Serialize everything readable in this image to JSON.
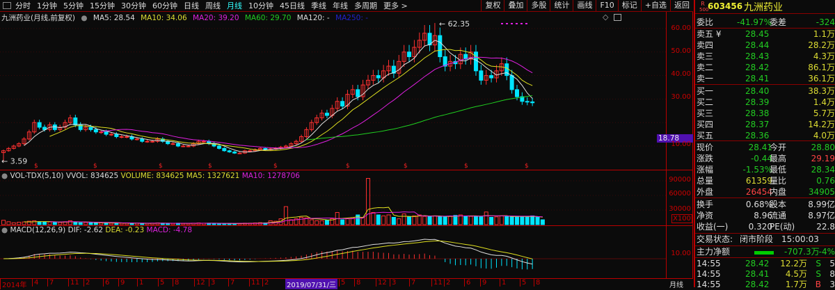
{
  "toolbar": {
    "tabs": [
      "分时",
      "1分钟",
      "5分钟",
      "15分钟",
      "30分钟",
      "60分钟",
      "日线",
      "周线",
      "月线",
      "10分钟",
      "45日线",
      "季线",
      "年线",
      "多周期",
      "更多 >"
    ],
    "active": "月线",
    "tools": [
      "复权",
      "叠加",
      "多股",
      "统计",
      "画线",
      "F10",
      "标记",
      "+自选",
      "返回"
    ]
  },
  "chart": {
    "title": "九洲药业(月线,前复权)",
    "ma5": "MA5: 28.54",
    "ma10": "MA10: 34.06",
    "ma20": "MA20: 39.20",
    "ma60": "MA60: 29.70",
    "ma120": "MA120: -",
    "ma250": "MA250: -",
    "high_label": "62.35",
    "low_label": "3.59",
    "cursor_price": "18.78",
    "price_ticks": [
      "60.00",
      "50.00",
      "40.00",
      "30.00",
      "10.00"
    ]
  },
  "volume": {
    "title": "VOL-TDX(5,10)",
    "vvol": "VVOL: 834625",
    "volume": "VOLUME: 834625",
    "ma5": "MA5: 1327621",
    "ma10": "MA10: 1278706",
    "ticks": [
      "90000",
      "60000",
      "30000"
    ],
    "unit": "X100"
  },
  "macd": {
    "title": "MACD(12,26,9)",
    "dif": "DIF: -2.62",
    "dea": "DEA: -0.23",
    "macd": "MACD: -4.78",
    "tick": "10.00"
  },
  "time_axis": {
    "labels": [
      "2014年",
      "4",
      "7",
      "11",
      "2",
      "6",
      "9",
      "1",
      "5",
      "8",
      "12",
      "3",
      "7",
      "11",
      "2",
      "5",
      "8",
      "12",
      "3",
      "7",
      "11",
      "2",
      "6",
      "9",
      "1",
      "5",
      "8"
    ],
    "cursor": "2019/07/31/三",
    "period": "月线"
  },
  "colors": {
    "up": "#ff3030",
    "down": "#00e5ff",
    "ma5": "#e0e0e0",
    "ma10": "#e0e020",
    "ma20": "#e020e0",
    "ma60": "#20d020"
  },
  "chart_data": {
    "type": "candlestick",
    "interval": "monthly",
    "close": [
      8,
      9,
      10,
      11,
      13,
      16,
      20,
      18,
      17,
      19,
      17,
      18,
      20,
      22,
      19,
      17,
      18,
      17,
      16,
      16,
      15,
      15,
      14,
      14,
      14,
      13,
      13,
      12,
      12,
      12,
      13,
      12,
      11,
      11,
      10,
      10,
      10,
      11,
      12,
      12,
      11,
      10,
      9,
      8,
      7.5,
      7,
      7,
      8,
      8,
      8.5,
      9,
      8.5,
      8.8,
      9,
      9.5,
      10,
      11,
      12,
      14,
      17,
      20,
      22,
      24,
      23,
      26,
      29,
      27,
      32,
      34,
      31,
      36,
      38,
      40,
      39,
      42,
      44,
      41,
      46,
      50,
      48,
      52,
      55,
      58,
      53,
      57,
      48,
      44,
      46,
      45,
      49,
      47,
      50,
      42,
      38,
      40,
      39,
      42,
      45,
      40,
      34,
      31,
      29,
      28.8,
      28.41
    ],
    "volume": [
      9000,
      6000,
      4000,
      5000,
      5500,
      7000,
      8000,
      6000,
      5000,
      5500,
      5000,
      4500,
      6000,
      8000,
      5000,
      4000,
      4500,
      4000,
      3500,
      3500,
      4000,
      3000,
      3500,
      3000,
      3000,
      2500,
      3000,
      2500,
      2800,
      3000,
      3500,
      3000,
      2500,
      2500,
      3000,
      2500,
      2500,
      3000,
      3500,
      3000,
      3000,
      2500,
      2000,
      2000,
      2500,
      2000,
      2500,
      3000,
      3000,
      3500,
      4000,
      3500,
      8000,
      7000,
      12000,
      37000,
      10000,
      12000,
      15000,
      14000,
      10000,
      8000,
      8000,
      9000,
      12000,
      25000,
      10000,
      12000,
      14000,
      20000,
      15000,
      95000,
      25000,
      20000,
      18000,
      20000,
      15000,
      12000,
      22000,
      16000,
      18000,
      20000,
      17000,
      17000,
      18000,
      17000,
      16000,
      17000,
      19000,
      20000,
      17000,
      17000,
      17000,
      16000,
      26000,
      15000,
      16000,
      18000,
      17000,
      17000,
      16000,
      16000,
      17000,
      18000,
      16000,
      10000
    ],
    "ylim": [
      0,
      65
    ]
  },
  "quote": {
    "code": "603456",
    "name": "九洲药业",
    "badge_top": "R",
    "badge_bottom": "500",
    "weibi_label": "委比",
    "weibi": "-41.97%",
    "weicha_label": "委差",
    "weicha": "-324",
    "sell": [
      {
        "label": "卖五 ¥",
        "price": "28.45",
        "vol": "1.1万"
      },
      {
        "label": "卖四",
        "price": "28.44",
        "vol": "28.2万"
      },
      {
        "label": "卖三",
        "price": "28.43",
        "vol": "4.3万"
      },
      {
        "label": "卖二",
        "price": "28.42",
        "vol": "86.1万"
      },
      {
        "label": "卖一",
        "price": "28.41",
        "vol": "36.1万"
      }
    ],
    "buy": [
      {
        "label": "买一",
        "price": "28.40",
        "vol": "38.3万"
      },
      {
        "label": "买二",
        "price": "28.39",
        "vol": "1.4万"
      },
      {
        "label": "买三",
        "price": "28.38",
        "vol": "5.7万"
      },
      {
        "label": "买四",
        "price": "28.37",
        "vol": "14.2万"
      },
      {
        "label": "买五",
        "price": "28.36",
        "vol": "4.0万"
      }
    ],
    "stats": [
      {
        "l1": "现价",
        "v1": "28.41",
        "c1": "g",
        "l2": "今开",
        "v2": "28.80",
        "c2": "g"
      },
      {
        "l1": "涨跌",
        "v1": "-0.44",
        "c1": "g",
        "l2": "最高",
        "v2": "29.19",
        "c2": "r"
      },
      {
        "l1": "涨幅",
        "v1": "-1.53%",
        "c1": "g",
        "l2": "最低",
        "v2": "28.34",
        "c2": "g"
      },
      {
        "l1": "总量",
        "v1": "61359",
        "c1": "y",
        "l2": "量比",
        "v2": "0.76",
        "c2": "g"
      },
      {
        "l1": "外盘",
        "v1": "26454",
        "c1": "r",
        "l2": "内盘",
        "v2": "34905",
        "c2": "g"
      }
    ],
    "fund": [
      {
        "l1": "换手",
        "v1": "0.68%",
        "l2": "股本",
        "v2": "8.99亿"
      },
      {
        "l1": "净资",
        "v1": "8.96",
        "l2": "流通",
        "v2": "8.97亿"
      },
      {
        "l1": "收益(一)",
        "v1": "0.320",
        "l2": "PE(动)",
        "v2": "22.8"
      }
    ],
    "status_label": "交易状态:",
    "status": "闭市阶段",
    "status_time": "15:00:03",
    "main_label": "主力净额",
    "main_value": "-707.3万",
    "main_pct": "-4%",
    "ticks": [
      {
        "time": "14:55",
        "price": "28.42",
        "vol": "12.2万",
        "side": "S",
        "n": "5"
      },
      {
        "time": "14:55",
        "price": "28.41",
        "vol": "4.5万",
        "side": "S",
        "n": "8"
      },
      {
        "time": "14:55",
        "price": "28.42",
        "vol": "1.7万",
        "side": "B",
        "n": "3"
      }
    ]
  }
}
